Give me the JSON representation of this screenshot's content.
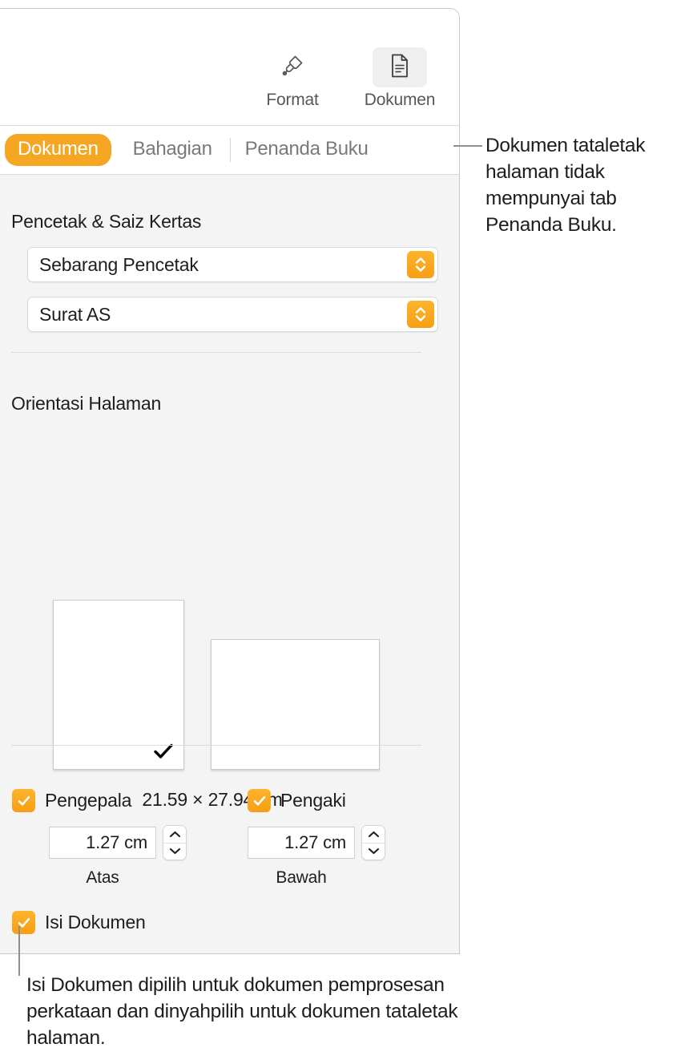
{
  "toolbar": {
    "buttons": [
      {
        "label": "Format",
        "icon": "paintbrush-icon",
        "selected": false
      },
      {
        "label": "Dokumen",
        "icon": "document-icon",
        "selected": true
      }
    ]
  },
  "tabs": [
    {
      "label": "Dokumen",
      "active": true
    },
    {
      "label": "Bahagian",
      "active": false
    },
    {
      "label": "Penanda Buku",
      "active": false
    }
  ],
  "printer_section": {
    "title": "Pencetak & Saiz Kertas",
    "printer": {
      "value": "Sebarang Pencetak",
      "icon": "up-down-chevron-icon"
    },
    "paper_size": {
      "value": "Surat AS",
      "icon": "up-down-chevron-icon"
    }
  },
  "orientation_section": {
    "title": "Orientasi Halaman",
    "portrait": {
      "name": "portrait",
      "selected": true,
      "icon": "checkmark-icon"
    },
    "landscape": {
      "name": "landscape",
      "selected": false
    },
    "page_size": "21.59 × 27.94 cm"
  },
  "header_footer_section": {
    "header": {
      "label": "Pengepala",
      "checked": true,
      "value": "1.27 cm",
      "sub_label": "Atas"
    },
    "footer": {
      "label": "Pengaki",
      "checked": true,
      "value": "1.27 cm",
      "sub_label": "Bawah"
    },
    "body": {
      "label": "Isi Dokumen",
      "checked": true
    }
  },
  "callouts": [
    {
      "id": "bookmarks-tab-callout",
      "text": "Dokumen tataletak halaman tidak mempunyai tab Penanda Buku."
    },
    {
      "id": "document-body-callout",
      "text": "Isi Dokumen dipilih untuk dokumen pemprosesan perkataan dan dinyahpilih untuk dokumen tataletak halaman."
    }
  ],
  "colors": {
    "accent_orange": "#f5a623",
    "panel_bg": "#f4f4f4",
    "toolbar_bg": "#ffffff",
    "text_primary": "#1d1d1f",
    "text_secondary": "#77797c"
  }
}
